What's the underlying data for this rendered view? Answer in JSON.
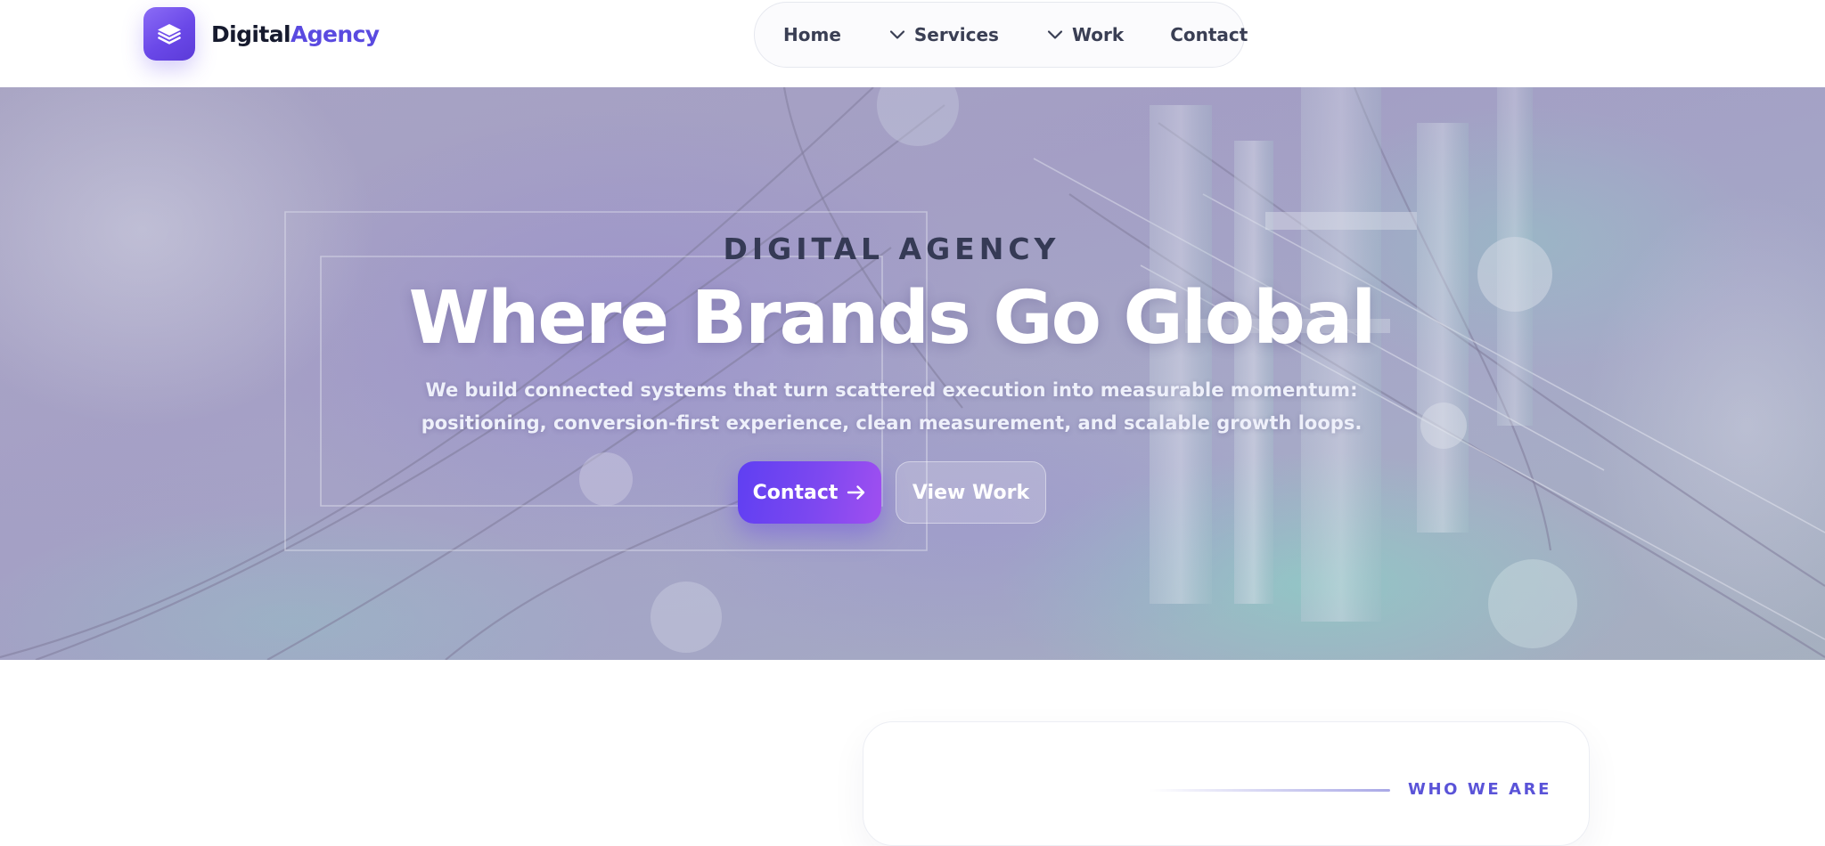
{
  "brand": {
    "name_main": "Digital",
    "name_accent": "Agency",
    "logo_icon": "stack-layers-icon",
    "accent_color": "#5a4ae0"
  },
  "nav": {
    "items": [
      {
        "label": "Home",
        "has_dropdown": false
      },
      {
        "label": "Services",
        "has_dropdown": true,
        "icon": "chevron-down-icon"
      },
      {
        "label": "Work",
        "has_dropdown": true,
        "icon": "chevron-down-icon"
      },
      {
        "label": "Contact",
        "has_dropdown": false
      }
    ]
  },
  "hero": {
    "eyebrow": "DIGITAL AGENCY",
    "title": "Where Brands Go Global",
    "subtitle_lines": [
      "We build connected systems that turn scattered execution into measurable momentum:",
      "positioning, conversion-first experience, clean measurement, and scalable growth loops."
    ],
    "primary_cta": {
      "label": "Contact",
      "icon": "arrow-right-icon",
      "color": "#6a44f0"
    },
    "secondary_cta": {
      "label": "View Work"
    }
  },
  "about": {
    "eyebrow": "WHO WE ARE"
  }
}
